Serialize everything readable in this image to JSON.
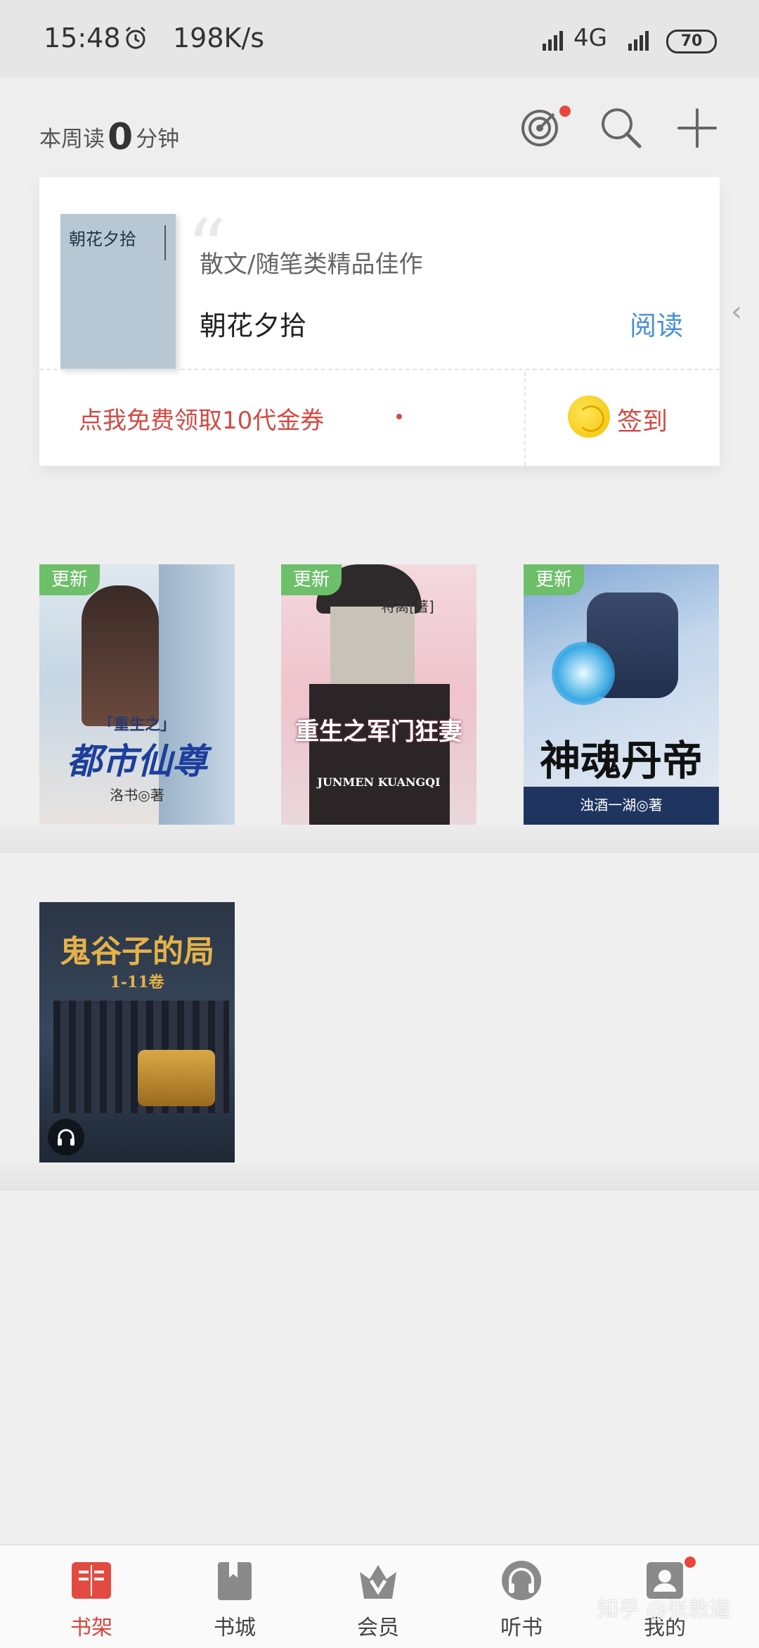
{
  "status_bar": {
    "time": "15:48",
    "speed": "198K/s",
    "network": "4G",
    "battery": "70"
  },
  "top_bar": {
    "week_read_prefix": "本周读",
    "week_read_minutes": "0",
    "week_read_suffix": "分钟"
  },
  "featured": {
    "cover_title": "朝花夕拾",
    "subtitle": "散文/随笔类精品佳作",
    "title": "朝花夕拾",
    "read_label": "阅读",
    "coupon_text": "点我免费领取10代金券",
    "checkin_label": "签到"
  },
  "books": [
    {
      "badge": "更新",
      "cover_title": "都市仙尊",
      "cover_sub": "「重生之」",
      "author": "洛书◎著"
    },
    {
      "badge": "更新",
      "cover_title": "重生之军门狂妻",
      "cover_sub": "JUNMEN KUANGQI",
      "author": "将离[著]"
    },
    {
      "badge": "更新",
      "cover_title": "神魂丹帝",
      "cover_sub": "",
      "author": "浊酒一湖◎著"
    },
    {
      "badge": "",
      "cover_title": "鬼谷子的局",
      "cover_sub": "1-11卷",
      "author": ""
    }
  ],
  "bottom_nav": [
    {
      "label": "书架",
      "active": true
    },
    {
      "label": "书城",
      "active": false
    },
    {
      "label": "会员",
      "active": false
    },
    {
      "label": "听书",
      "active": false
    },
    {
      "label": "我的",
      "active": false
    }
  ],
  "watermark": "知乎 @张敦道",
  "colors": {
    "accent_red": "#d9453c",
    "read_blue": "#4a90d9",
    "badge_green": "#6ebf6a"
  }
}
